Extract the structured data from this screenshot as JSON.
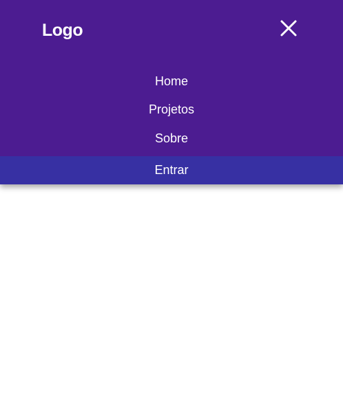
{
  "header": {
    "logo_text": "Logo",
    "close_icon": "close-icon"
  },
  "menu": {
    "items": [
      {
        "label": "Home"
      },
      {
        "label": "Projetos"
      },
      {
        "label": "Sobre"
      }
    ],
    "login_label": "Entrar"
  },
  "colors": {
    "nav_background": "#4c1c91",
    "login_background": "#3730a3",
    "text": "#ffffff",
    "page_background": "#ffffff"
  }
}
